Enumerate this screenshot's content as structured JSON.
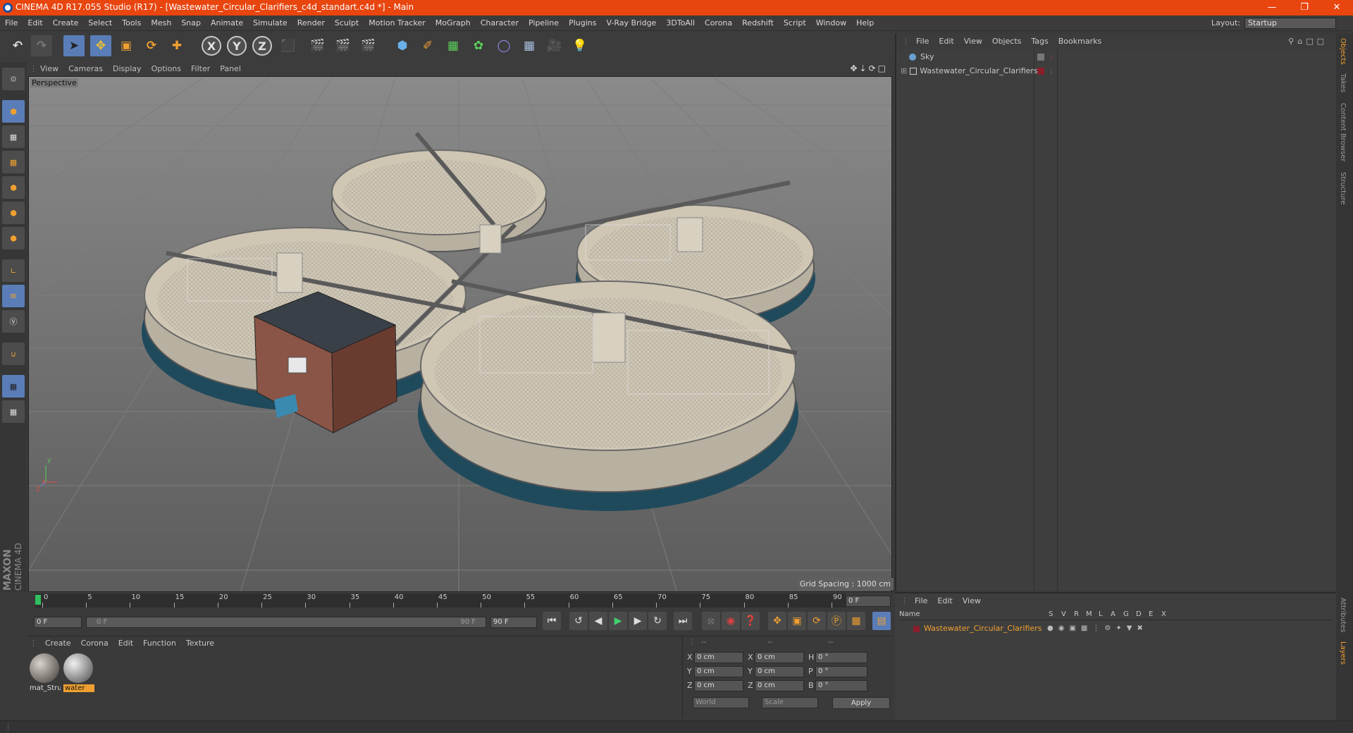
{
  "title": "CINEMA 4D R17.055 Studio (R17) - [Wastewater_Circular_Clarifiers_c4d_standart.c4d *] - Main",
  "menu": [
    "File",
    "Edit",
    "Create",
    "Select",
    "Tools",
    "Mesh",
    "Snap",
    "Animate",
    "Simulate",
    "Render",
    "Sculpt",
    "Motion Tracker",
    "MoGraph",
    "Character",
    "Pipeline",
    "Plugins",
    "V-Ray Bridge",
    "3DToAll",
    "Corona",
    "Redshift",
    "Script",
    "Window",
    "Help"
  ],
  "layout": {
    "label": "Layout:",
    "value": "Startup"
  },
  "viewport": {
    "menu": [
      "View",
      "Cameras",
      "Display",
      "Options",
      "Filter",
      "Panel"
    ],
    "label": "Perspective",
    "grid_spacing": "Grid Spacing : 1000 cm",
    "axis": {
      "x": "X",
      "y": "Y",
      "z": "Z"
    }
  },
  "object_manager": {
    "menu": [
      "File",
      "Edit",
      "View",
      "Objects",
      "Tags",
      "Bookmarks"
    ],
    "objects": [
      {
        "name": "Sky"
      },
      {
        "name": "Wastewater_Circular_Clarifiers"
      }
    ]
  },
  "layer_manager": {
    "menu": [
      "File",
      "Edit",
      "View"
    ],
    "header": {
      "name": "Name",
      "cols": [
        "S",
        "V",
        "R",
        "M",
        "L",
        "A",
        "G",
        "D",
        "E",
        "X"
      ]
    },
    "layers": [
      {
        "name": "Wastewater_Circular_Clarifiers"
      }
    ]
  },
  "timeline": {
    "ticks": [
      "0",
      "5",
      "10",
      "15",
      "20",
      "25",
      "30",
      "35",
      "40",
      "45",
      "50",
      "55",
      "60",
      "65",
      "70",
      "75",
      "80",
      "85",
      "90"
    ],
    "current_frame": "0 F",
    "start_field": "0 F",
    "range_start": "0 F",
    "range_end": "90 F",
    "end_field": "90 F"
  },
  "material_manager": {
    "menu": [
      "Create",
      "Corona",
      "Edit",
      "Function",
      "Texture"
    ],
    "materials": [
      {
        "name": "mat_Stru",
        "selected": false
      },
      {
        "name": "water",
        "selected": true
      }
    ]
  },
  "attributes": {
    "header": [
      "--",
      "--",
      "--"
    ],
    "rows": [
      {
        "a": "X",
        "av": "0 cm",
        "b": "X",
        "bv": "0 cm",
        "c": "H",
        "cv": "0 °"
      },
      {
        "a": "Y",
        "av": "0 cm",
        "b": "Y",
        "bv": "0 cm",
        "c": "P",
        "cv": "0 °"
      },
      {
        "a": "Z",
        "av": "0 cm",
        "b": "Z",
        "bv": "0 cm",
        "c": "B",
        "cv": "0 °"
      }
    ],
    "coord_system": "World",
    "size_mode": "Scale",
    "apply": "Apply"
  },
  "side_tabs": [
    "Objects",
    "Takes",
    "Content Browser",
    "Structure"
  ],
  "side_tabs_bottom": [
    "Attributes",
    "Layers"
  ],
  "brand": {
    "maxon": "MAXON",
    "c4d": "CINEMA 4D"
  }
}
